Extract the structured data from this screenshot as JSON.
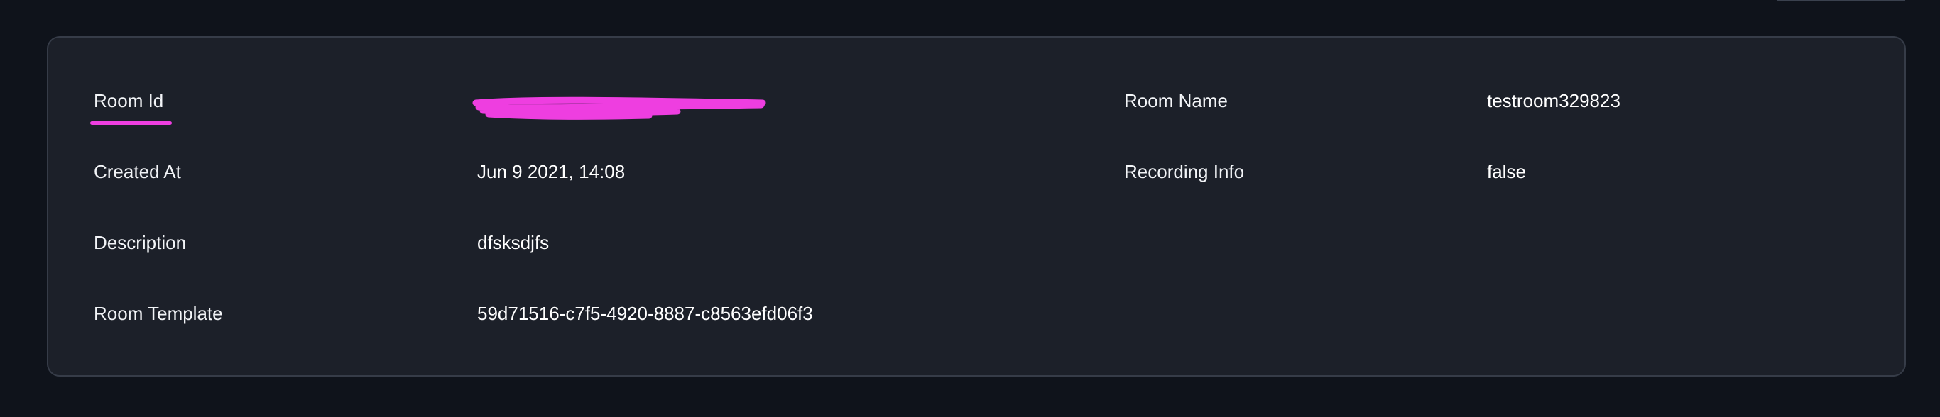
{
  "colors": {
    "redaction": "#ee3ee0",
    "underline": "#ee3ee0"
  },
  "room_details": {
    "room_id_label": "Room Id",
    "room_id_value": "",
    "room_name_label": "Room Name",
    "room_name_value": "testroom329823",
    "created_at_label": "Created At",
    "created_at_value": "Jun 9 2021, 14:08",
    "recording_info_label": "Recording Info",
    "recording_info_value": "false",
    "description_label": "Description",
    "description_value": "dfsksdjfs",
    "room_template_label": "Room Template",
    "room_template_value": "59d71516-c7f5-4920-8887-c8563efd06f3"
  }
}
